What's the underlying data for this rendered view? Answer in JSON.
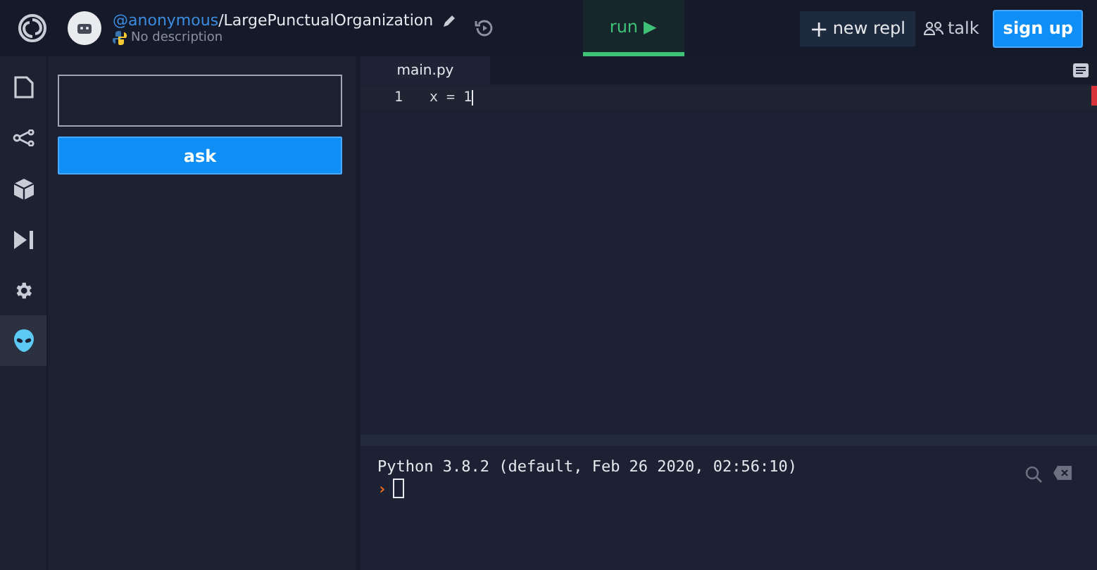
{
  "header": {
    "owner": "@anonymous",
    "separator": "/",
    "repl_name": "LargePunctualOrganization",
    "description": "No description",
    "run_label": "run",
    "run_icon": "▶",
    "new_repl_icon": "+",
    "new_repl": "new repl",
    "talk": "talk",
    "sign_up": "sign up"
  },
  "sidebar": {
    "items": [
      {
        "kind": "files",
        "selected": false
      },
      {
        "kind": "share",
        "selected": false
      },
      {
        "kind": "packages",
        "selected": false
      },
      {
        "kind": "debugger",
        "selected": false
      },
      {
        "kind": "settings",
        "selected": false
      },
      {
        "kind": "alien",
        "selected": true
      }
    ]
  },
  "ask_panel": {
    "button": "ask"
  },
  "editor": {
    "tabs": [
      {
        "label": "main.py",
        "selected": true
      }
    ],
    "lines": [
      {
        "number": "1",
        "code": "x = 1"
      }
    ]
  },
  "console": {
    "lines": [
      "Python 3.8.2 (default, Feb 26 2020, 02:56:10)"
    ],
    "prompt": "›"
  }
}
